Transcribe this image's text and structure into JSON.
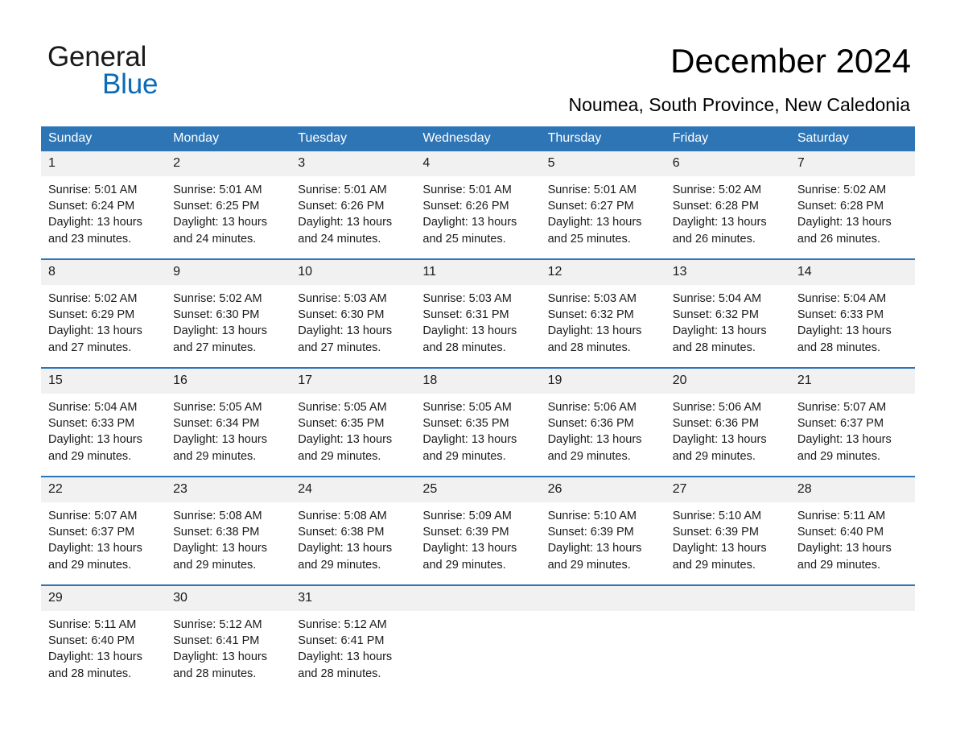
{
  "brand": {
    "word1": "General",
    "word2": "Blue",
    "triangle_icon": "brand-triangle-icon",
    "colors": {
      "blue": "#0c6ab6",
      "dark": "#1a1a1a"
    }
  },
  "header": {
    "title": "December 2024",
    "subtitle": "Noumea, South Province, New Caledonia"
  },
  "theme": {
    "header_blue": "#2e75b6",
    "day_band_gray": "#f1f1f1",
    "text": "#1a1a1a",
    "page_background": "#ffffff"
  },
  "calendar": {
    "weekday_headers": [
      "Sunday",
      "Monday",
      "Tuesday",
      "Wednesday",
      "Thursday",
      "Friday",
      "Saturday"
    ],
    "weeks": [
      {
        "days": [
          {
            "num": "1",
            "sunrise": "Sunrise: 5:01 AM",
            "sunset": "Sunset: 6:24 PM",
            "daylight1": "Daylight: 13 hours",
            "daylight2": "and 23 minutes."
          },
          {
            "num": "2",
            "sunrise": "Sunrise: 5:01 AM",
            "sunset": "Sunset: 6:25 PM",
            "daylight1": "Daylight: 13 hours",
            "daylight2": "and 24 minutes."
          },
          {
            "num": "3",
            "sunrise": "Sunrise: 5:01 AM",
            "sunset": "Sunset: 6:26 PM",
            "daylight1": "Daylight: 13 hours",
            "daylight2": "and 24 minutes."
          },
          {
            "num": "4",
            "sunrise": "Sunrise: 5:01 AM",
            "sunset": "Sunset: 6:26 PM",
            "daylight1": "Daylight: 13 hours",
            "daylight2": "and 25 minutes."
          },
          {
            "num": "5",
            "sunrise": "Sunrise: 5:01 AM",
            "sunset": "Sunset: 6:27 PM",
            "daylight1": "Daylight: 13 hours",
            "daylight2": "and 25 minutes."
          },
          {
            "num": "6",
            "sunrise": "Sunrise: 5:02 AM",
            "sunset": "Sunset: 6:28 PM",
            "daylight1": "Daylight: 13 hours",
            "daylight2": "and 26 minutes."
          },
          {
            "num": "7",
            "sunrise": "Sunrise: 5:02 AM",
            "sunset": "Sunset: 6:28 PM",
            "daylight1": "Daylight: 13 hours",
            "daylight2": "and 26 minutes."
          }
        ]
      },
      {
        "days": [
          {
            "num": "8",
            "sunrise": "Sunrise: 5:02 AM",
            "sunset": "Sunset: 6:29 PM",
            "daylight1": "Daylight: 13 hours",
            "daylight2": "and 27 minutes."
          },
          {
            "num": "9",
            "sunrise": "Sunrise: 5:02 AM",
            "sunset": "Sunset: 6:30 PM",
            "daylight1": "Daylight: 13 hours",
            "daylight2": "and 27 minutes."
          },
          {
            "num": "10",
            "sunrise": "Sunrise: 5:03 AM",
            "sunset": "Sunset: 6:30 PM",
            "daylight1": "Daylight: 13 hours",
            "daylight2": "and 27 minutes."
          },
          {
            "num": "11",
            "sunrise": "Sunrise: 5:03 AM",
            "sunset": "Sunset: 6:31 PM",
            "daylight1": "Daylight: 13 hours",
            "daylight2": "and 28 minutes."
          },
          {
            "num": "12",
            "sunrise": "Sunrise: 5:03 AM",
            "sunset": "Sunset: 6:32 PM",
            "daylight1": "Daylight: 13 hours",
            "daylight2": "and 28 minutes."
          },
          {
            "num": "13",
            "sunrise": "Sunrise: 5:04 AM",
            "sunset": "Sunset: 6:32 PM",
            "daylight1": "Daylight: 13 hours",
            "daylight2": "and 28 minutes."
          },
          {
            "num": "14",
            "sunrise": "Sunrise: 5:04 AM",
            "sunset": "Sunset: 6:33 PM",
            "daylight1": "Daylight: 13 hours",
            "daylight2": "and 28 minutes."
          }
        ]
      },
      {
        "days": [
          {
            "num": "15",
            "sunrise": "Sunrise: 5:04 AM",
            "sunset": "Sunset: 6:33 PM",
            "daylight1": "Daylight: 13 hours",
            "daylight2": "and 29 minutes."
          },
          {
            "num": "16",
            "sunrise": "Sunrise: 5:05 AM",
            "sunset": "Sunset: 6:34 PM",
            "daylight1": "Daylight: 13 hours",
            "daylight2": "and 29 minutes."
          },
          {
            "num": "17",
            "sunrise": "Sunrise: 5:05 AM",
            "sunset": "Sunset: 6:35 PM",
            "daylight1": "Daylight: 13 hours",
            "daylight2": "and 29 minutes."
          },
          {
            "num": "18",
            "sunrise": "Sunrise: 5:05 AM",
            "sunset": "Sunset: 6:35 PM",
            "daylight1": "Daylight: 13 hours",
            "daylight2": "and 29 minutes."
          },
          {
            "num": "19",
            "sunrise": "Sunrise: 5:06 AM",
            "sunset": "Sunset: 6:36 PM",
            "daylight1": "Daylight: 13 hours",
            "daylight2": "and 29 minutes."
          },
          {
            "num": "20",
            "sunrise": "Sunrise: 5:06 AM",
            "sunset": "Sunset: 6:36 PM",
            "daylight1": "Daylight: 13 hours",
            "daylight2": "and 29 minutes."
          },
          {
            "num": "21",
            "sunrise": "Sunrise: 5:07 AM",
            "sunset": "Sunset: 6:37 PM",
            "daylight1": "Daylight: 13 hours",
            "daylight2": "and 29 minutes."
          }
        ]
      },
      {
        "days": [
          {
            "num": "22",
            "sunrise": "Sunrise: 5:07 AM",
            "sunset": "Sunset: 6:37 PM",
            "daylight1": "Daylight: 13 hours",
            "daylight2": "and 29 minutes."
          },
          {
            "num": "23",
            "sunrise": "Sunrise: 5:08 AM",
            "sunset": "Sunset: 6:38 PM",
            "daylight1": "Daylight: 13 hours",
            "daylight2": "and 29 minutes."
          },
          {
            "num": "24",
            "sunrise": "Sunrise: 5:08 AM",
            "sunset": "Sunset: 6:38 PM",
            "daylight1": "Daylight: 13 hours",
            "daylight2": "and 29 minutes."
          },
          {
            "num": "25",
            "sunrise": "Sunrise: 5:09 AM",
            "sunset": "Sunset: 6:39 PM",
            "daylight1": "Daylight: 13 hours",
            "daylight2": "and 29 minutes."
          },
          {
            "num": "26",
            "sunrise": "Sunrise: 5:10 AM",
            "sunset": "Sunset: 6:39 PM",
            "daylight1": "Daylight: 13 hours",
            "daylight2": "and 29 minutes."
          },
          {
            "num": "27",
            "sunrise": "Sunrise: 5:10 AM",
            "sunset": "Sunset: 6:39 PM",
            "daylight1": "Daylight: 13 hours",
            "daylight2": "and 29 minutes."
          },
          {
            "num": "28",
            "sunrise": "Sunrise: 5:11 AM",
            "sunset": "Sunset: 6:40 PM",
            "daylight1": "Daylight: 13 hours",
            "daylight2": "and 29 minutes."
          }
        ]
      },
      {
        "days": [
          {
            "num": "29",
            "sunrise": "Sunrise: 5:11 AM",
            "sunset": "Sunset: 6:40 PM",
            "daylight1": "Daylight: 13 hours",
            "daylight2": "and 28 minutes."
          },
          {
            "num": "30",
            "sunrise": "Sunrise: 5:12 AM",
            "sunset": "Sunset: 6:41 PM",
            "daylight1": "Daylight: 13 hours",
            "daylight2": "and 28 minutes."
          },
          {
            "num": "31",
            "sunrise": "Sunrise: 5:12 AM",
            "sunset": "Sunset: 6:41 PM",
            "daylight1": "Daylight: 13 hours",
            "daylight2": "and 28 minutes."
          },
          {
            "num": "",
            "sunrise": "",
            "sunset": "",
            "daylight1": "",
            "daylight2": ""
          },
          {
            "num": "",
            "sunrise": "",
            "sunset": "",
            "daylight1": "",
            "daylight2": ""
          },
          {
            "num": "",
            "sunrise": "",
            "sunset": "",
            "daylight1": "",
            "daylight2": ""
          },
          {
            "num": "",
            "sunrise": "",
            "sunset": "",
            "daylight1": "",
            "daylight2": ""
          }
        ]
      }
    ]
  }
}
